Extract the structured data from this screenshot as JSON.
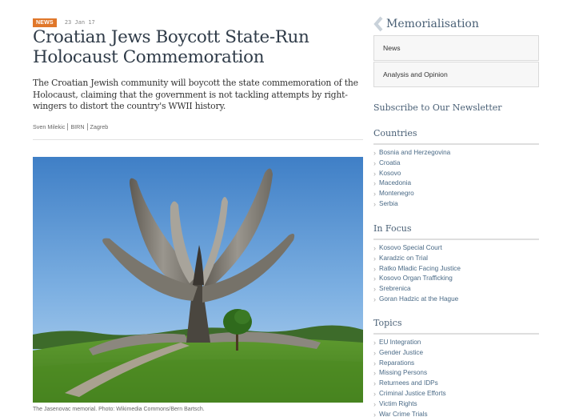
{
  "article": {
    "badge": "NEWS",
    "date": "23 Jan 17",
    "title": "Croatian Jews Boycott State-Run Holocaust Commemoration",
    "lede": "The Croatian Jewish community will boycott the state commemoration of the Holocaust, claiming that the government is not tackling attempts by right-wingers to distort the country's WWII history.",
    "byline": [
      "Sven Milekic",
      "BIRN",
      "Zagreb"
    ],
    "caption": "The Jasenovac memorial. Photo: Wikimedia Commons/Bern Bartsch."
  },
  "sidebar": {
    "section_title": "Memorialisation",
    "nav": [
      "News",
      "Analysis and Opinion"
    ],
    "newsletter": "Subscribe to Our Newsletter",
    "countries": {
      "title": "Countries",
      "items": [
        "Bosnia and Herzegovina",
        "Croatia",
        "Kosovo",
        "Macedonia",
        "Montenegro",
        "Serbia"
      ]
    },
    "in_focus": {
      "title": "In Focus",
      "items": [
        "Kosovo Special Court",
        "Karadzic on Trial",
        "Ratko Mladic Facing Justice",
        "Kosovo Organ Trafficking",
        "Srebrenica",
        "Goran Hadzic at the Hague"
      ]
    },
    "topics": {
      "title": "Topics",
      "items": [
        "EU Integration",
        "Gender Justice",
        "Reparations",
        "Missing Persons",
        "Returnees and IDPs",
        "Criminal Justice Efforts",
        "Victim Rights",
        "War Crime Trials"
      ]
    }
  },
  "colors": {
    "badge": "#e0772a",
    "title": "#2f3b48",
    "accent": "#4a6076",
    "link": "#4a6a86"
  }
}
